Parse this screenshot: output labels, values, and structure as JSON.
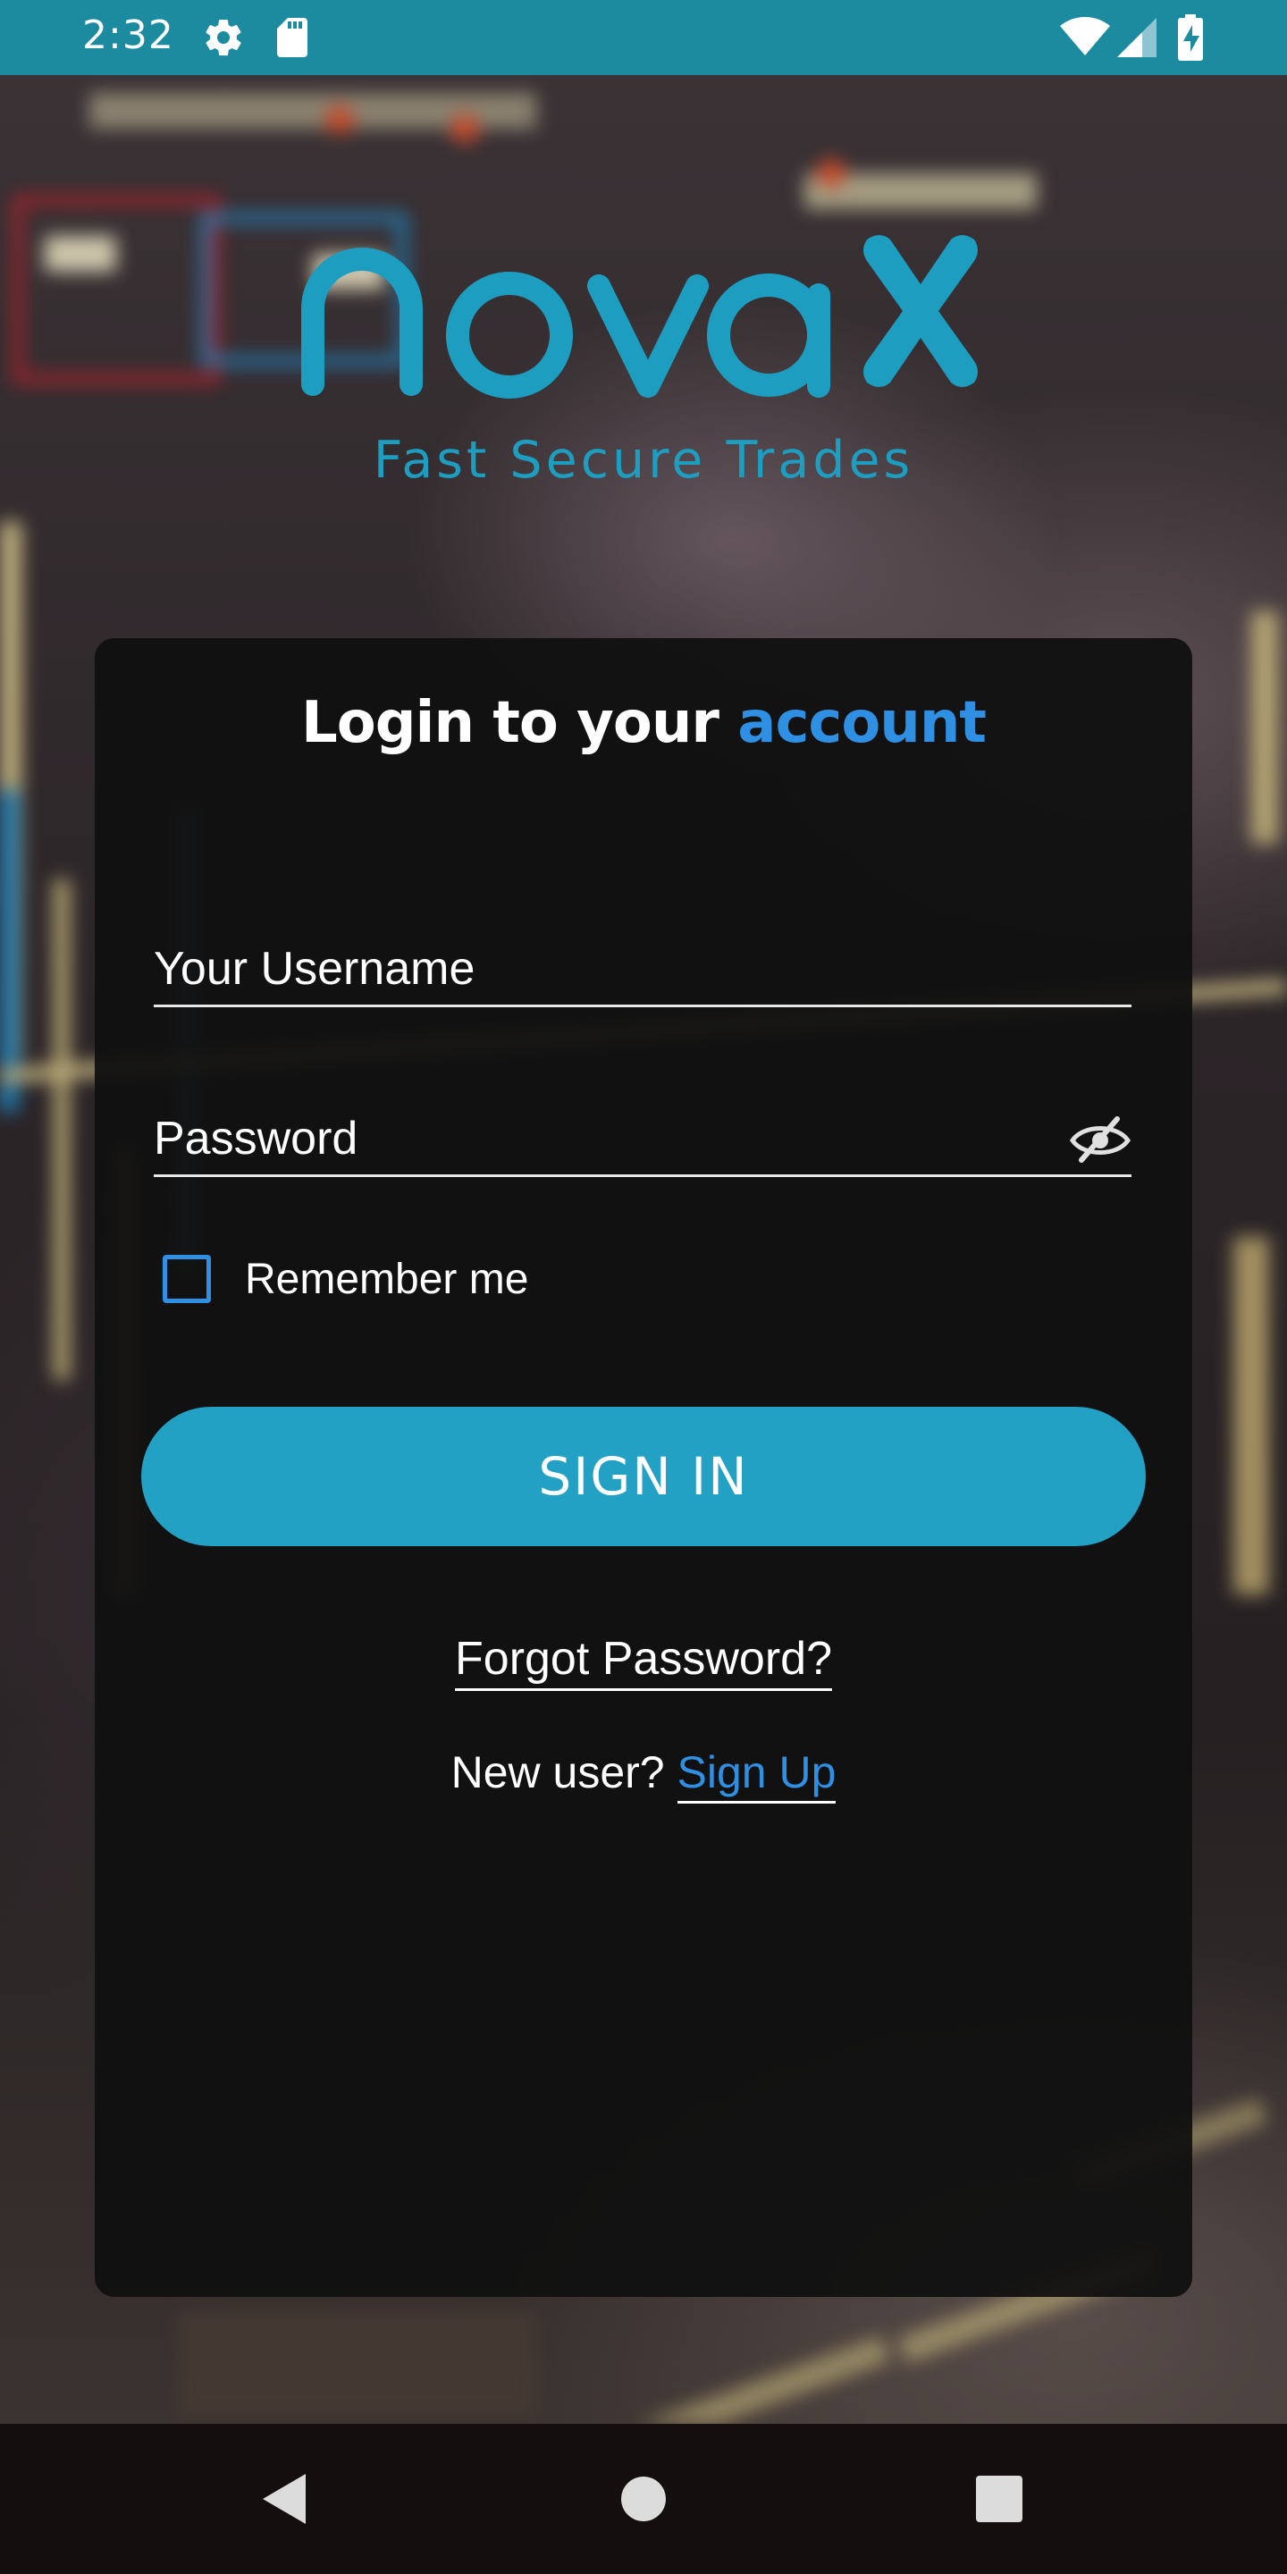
{
  "status_bar": {
    "time": "2:32",
    "icons": [
      "settings-icon",
      "sd-card-icon",
      "wifi-icon",
      "cell-signal-icon",
      "battery-charging-icon"
    ]
  },
  "logo": {
    "brand": "nova X",
    "tagline": "Fast Secure Trades",
    "color": "#1d9dbf"
  },
  "login_card": {
    "title_prefix": "Login to your",
    "title_accent": "account",
    "username_placeholder": "Your Username",
    "username_value": "",
    "password_placeholder": "Password",
    "password_value": "",
    "password_toggle_icon": "eye-off-icon",
    "remember_label": "Remember me",
    "remember_checked": false,
    "signin_label": "SIGN IN",
    "forgot_label": "Forgot Password?",
    "new_user_text": "New user?",
    "signup_label": "Sign Up"
  },
  "nav_bar": {
    "buttons": [
      "back-icon",
      "home-icon",
      "recents-icon"
    ]
  },
  "colors": {
    "accent": "#2f8fe3",
    "primary": "#22a1c4",
    "status_bar": "#1c8ba0"
  }
}
